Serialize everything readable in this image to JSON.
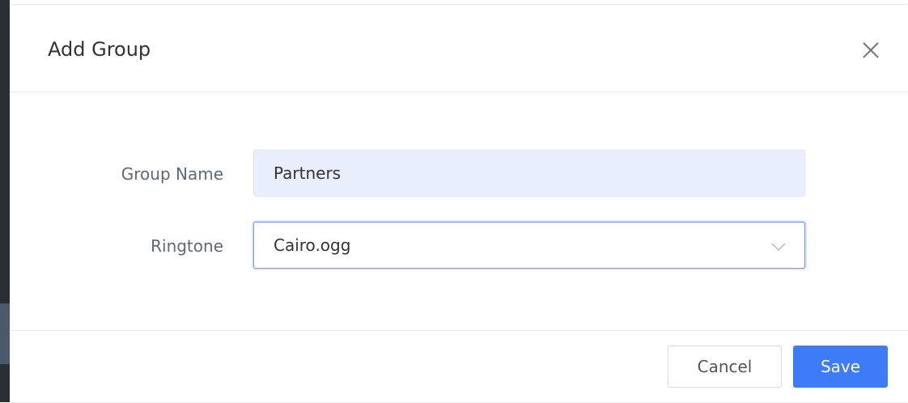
{
  "dialog": {
    "title": "Add Group",
    "close_icon": "close-icon"
  },
  "form": {
    "group_name": {
      "label": "Group Name",
      "value": "Partners"
    },
    "ringtone": {
      "label": "Ringtone",
      "selected": "Cairo.ogg",
      "icon": "chevron-down-icon"
    }
  },
  "footer": {
    "cancel_label": "Cancel",
    "save_label": "Save"
  },
  "colors": {
    "primary": "#3d7bf7",
    "input_bg": "#e8eefb",
    "label": "#5d6878"
  }
}
